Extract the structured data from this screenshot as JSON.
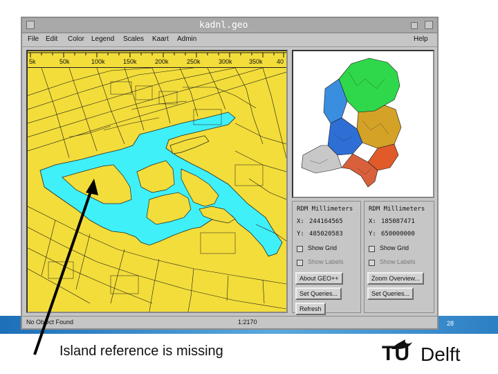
{
  "window": {
    "title": "kadnl.geo",
    "menu": [
      "File",
      "Edit",
      "Color",
      "Legend",
      "Scales",
      "Kaart",
      "Admin"
    ],
    "help": "Help"
  },
  "map": {
    "scale_labels": [
      "5k",
      "50k",
      "100k",
      "150k",
      "200k",
      "250k",
      "300k",
      "350k",
      "40"
    ]
  },
  "panels": {
    "left": {
      "title": "RDM Millimeters",
      "x_label": "X:",
      "x_value": "244164565",
      "y_label": "Y:",
      "y_value": "485020583",
      "show_grid": "Show Grid",
      "show_labels": "Show Labels",
      "buttons": [
        "About GEO++",
        "Set Queries...",
        "Refresh"
      ]
    },
    "right": {
      "title": "RDM Millimeters",
      "x_label": "X:",
      "x_value": "185087471",
      "y_label": "Y:",
      "y_value": "650000000",
      "show_grid": "Show Grid",
      "show_labels": "Show Labels",
      "buttons": [
        "Zoom Overview...",
        "Set Queries..."
      ]
    }
  },
  "status": {
    "message": "No Object Found",
    "scale": "1:2170"
  },
  "slide": {
    "page_number": "28",
    "caption": "Island reference is missing",
    "logo_tu": "TU",
    "logo_delft": "Delft"
  },
  "colors": {
    "map_background": "#f3dd3a",
    "water": "#3ff0f8",
    "footer_band": "#1d6fb8"
  }
}
